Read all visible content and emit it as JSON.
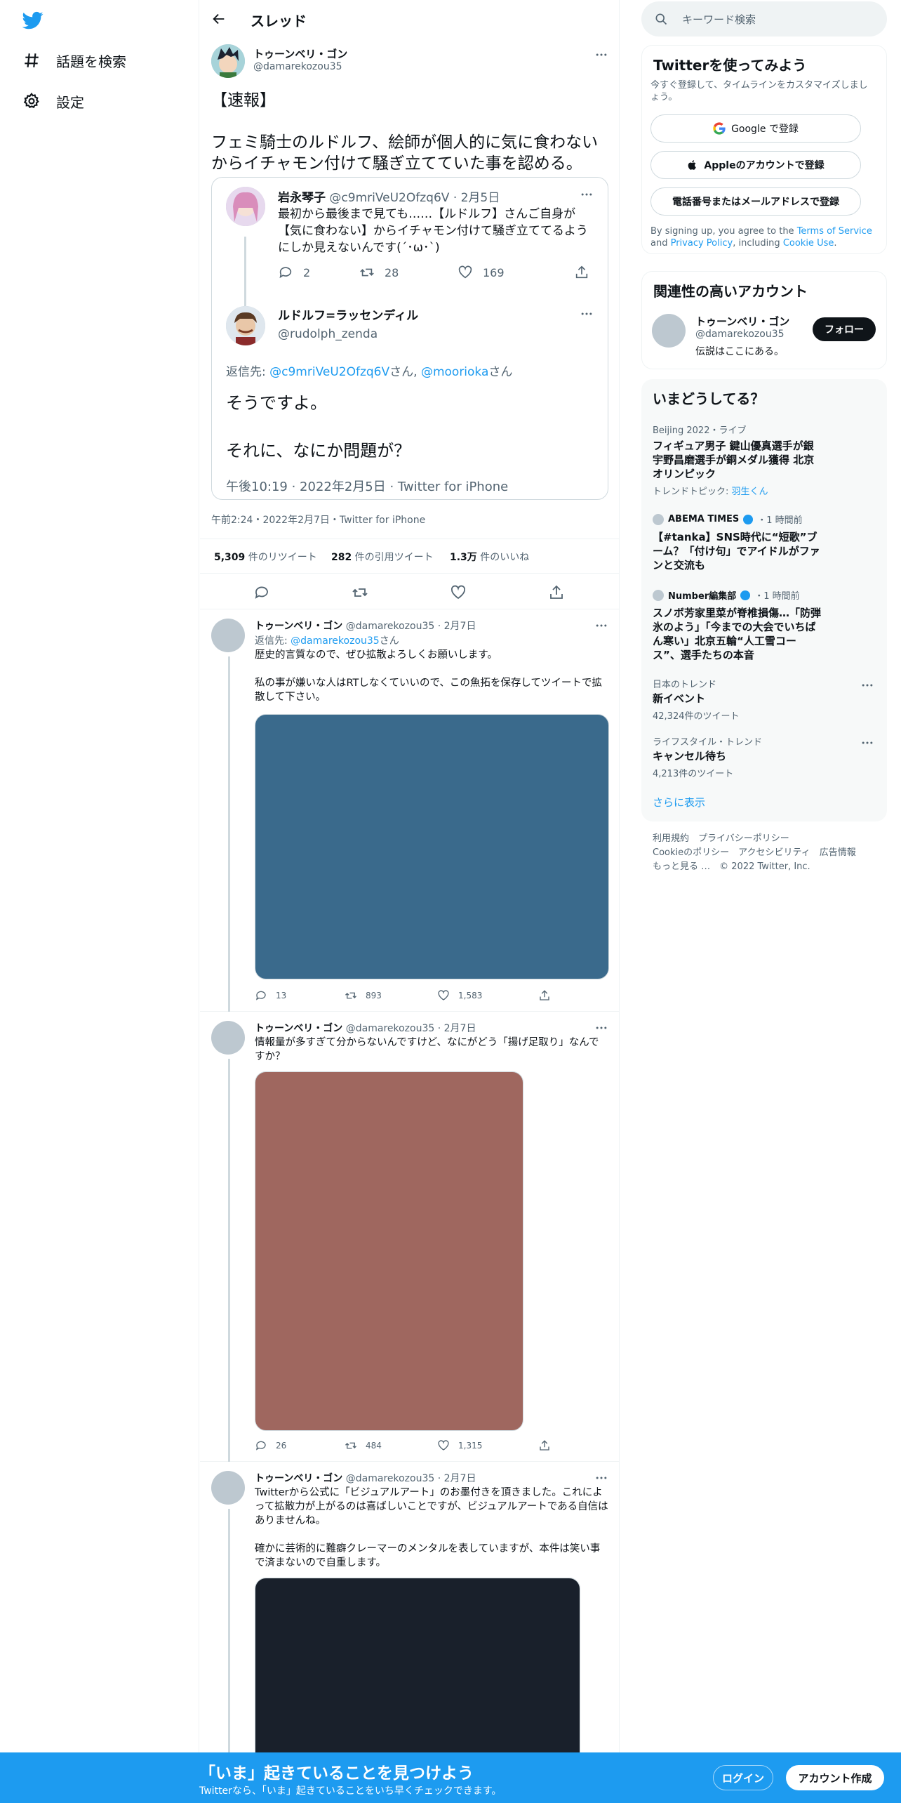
{
  "nav": {
    "explore_label": "話題を検索",
    "settings_label": "設定"
  },
  "header": {
    "title": "スレッド"
  },
  "tweet": {
    "name": "トゥーンベリ・ゴン",
    "handle": "@damarekozou35",
    "text": "【速報】\n\nフェミ騎士のルドルフ、絵師が個人的に気に食わないからイチャモン付けて騒ぎ立てていた事を認める。",
    "quote": {
      "first": {
        "name": "岩永琴子",
        "handle": "@c9mriVeU2Ofzq6V",
        "date": "· 2月5日",
        "text": "最初から最後まで見ても……【ルドルフ】さんご自身が【気に食わない】からイチャモン付けて騒ぎ立ててるようにしか見えないんです(´･ω･`)",
        "replies": "2",
        "retweets": "28",
        "likes": "169"
      },
      "second": {
        "name": "ルドルフ=ラッセンディル",
        "handle": "@rudolph_zenda",
        "reply_prefix": "返信先: ",
        "reply_to1": "@c9mriVeU2Ofzq6V",
        "san1": "さん, ",
        "reply_to2": "@moorioka",
        "san2": "さん",
        "text": "そうですよ。\n\nそれに、なにか問題が？",
        "timestamp": "午後10:19 · 2022年2月5日 · Twitter for iPhone"
      }
    },
    "timestamp": "午前2:24・2022年2月7日・Twitter for iPhone",
    "stats": {
      "retweets": "5,309",
      "retweets_label": " 件のリツイート",
      "quotes": "282",
      "quotes_label": " 件の引用ツイート",
      "likes": "1.3万",
      "likes_label": " 件のいいね"
    }
  },
  "replies": [
    {
      "name": "トゥーンベリ・ゴン",
      "handle": "@damarekozou35",
      "date": "· 2月7日",
      "reply_prefix": "返信先: ",
      "reply_to": "@damarekozou35",
      "san": "さん",
      "text": "歴史的言質なので、ぜひ拡散よろしくお願いします。\n\n私の事が嫌いな人はRTしなくていいので、この魚拓を保存してツイートで拡散して下さい。",
      "media_color": "#3a6a8c",
      "replies": "13",
      "retweets": "893",
      "likes": "1,583"
    },
    {
      "name": "トゥーンベリ・ゴン",
      "handle": "@damarekozou35",
      "date": "· 2月7日",
      "text": "情報量が多すぎて分からないんですけど、なにがどう「揚げ足取り」なんですか？",
      "media_color": "#9f675f",
      "replies": "26",
      "retweets": "484",
      "likes": "1,315"
    },
    {
      "name": "トゥーンベリ・ゴン",
      "handle": "@damarekozou35",
      "date": "· 2月7日",
      "text": "Twitterから公式に「ビジュアルアート」のお墨付きを頂きました。これによって拡散力が上がるのは喜ばしいことですが、ビジュアルアートである自信はありませんね。\n\n確かに芸術的に難癖クレーマーのメンタルを表していますが、本件は笑い事で済まないので自重します。",
      "media_color": "#19202b"
    }
  ],
  "sidebar": {
    "search_placeholder": "キーワード検索",
    "signup": {
      "title": "Twitterを使ってみよう",
      "subtitle": "今すぐ登録して、タイムラインをカスタマイズしましょう。",
      "google": "Google で登録",
      "apple": "Appleのアカウントで登録",
      "phone": "電話番号またはメールアドレスで登録",
      "terms1": "By signing up, you agree to the ",
      "terms_link": "Terms of Service",
      "terms2": " and ",
      "privacy_link": "Privacy Policy",
      "terms3": ", including ",
      "cookie_link": "Cookie Use",
      "terms4": "."
    },
    "related": {
      "title": "関連性の高いアカウント",
      "name": "トゥーンベリ・ゴン",
      "handle": "@damarekozou35",
      "bio": "伝説はここにある。",
      "follow": "フォロー"
    },
    "trends": {
      "title": "いまどうしてる？",
      "items": [
        {
          "cat": "Beijing 2022・ライブ",
          "title": "フィギュア男子 鍵山優真選手が銀 宇野昌磨選手が銅メダル獲得 北京オリンピック",
          "extra_label": "トレンドトピック: ",
          "extra_link": "羽生くん"
        },
        {
          "source": "ABEMA TIMES",
          "time": "・1 時間前",
          "title": "【#tanka】SNS時代に“短歌”ブーム？「付け句」でアイドルがファンと交流も"
        },
        {
          "source": "Number編集部",
          "time": "・1 時間前",
          "title": "スノボ芳家里菜が脊椎損傷…「防弾氷のよう」「今までの大会でいちばん寒い」北京五輪“人工雪コース”、選手たちの本音"
        },
        {
          "cat": "日本のトレンド",
          "title": "新イベント",
          "count": "42,324件のツイート"
        },
        {
          "cat": "ライフスタイル・トレンド",
          "title": "キャンセル待ち",
          "count": "4,213件のツイート"
        }
      ],
      "show_more": "さらに表示"
    },
    "footer": {
      "terms": "利用規約",
      "privacy": "プライバシーポリシー",
      "cookie": "Cookieのポリシー",
      "accessibility": "アクセシビリティ",
      "ads": "広告情報",
      "more": "もっと見る …",
      "copyright": "© 2022 Twitter, Inc."
    }
  },
  "bottom_bar": {
    "title": "「いま」起きていることを見つけよう",
    "subtitle": "Twitterなら、「いま」起きていることをいち早くチェックできます。",
    "login": "ログイン",
    "signup": "アカウント作成"
  },
  "colors": {
    "accent": "#1d9bf0",
    "text": "#0f1419",
    "muted": "#536471"
  }
}
